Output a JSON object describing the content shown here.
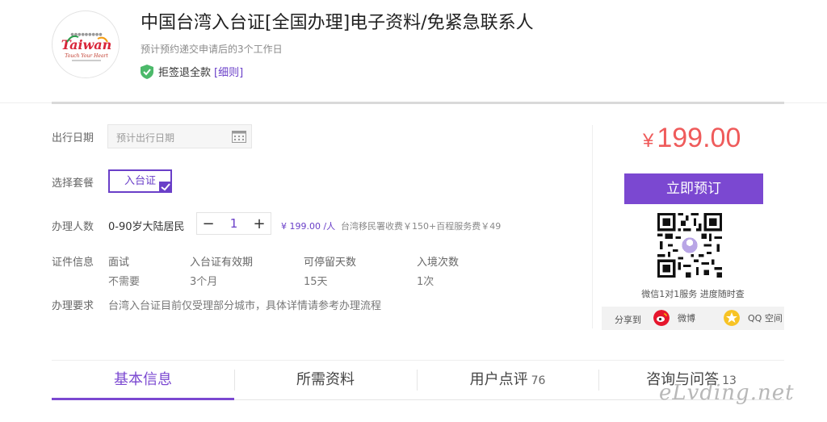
{
  "product": {
    "title": "中国台湾入台证[全国办理]电子资料/免紧急联系人",
    "subtitle": "预计预约递交申请后的3个工作日",
    "refund_label": "拒签退全款",
    "refund_detail_link": "[细则]",
    "logo_text": "Taiwan",
    "logo_slogan": "Touch Your Heart"
  },
  "form": {
    "date_label": "出行日期",
    "date_placeholder": "预计出行日期",
    "package_label": "选择套餐",
    "package_selected": "入台证",
    "persons_label": "办理人数",
    "person_type": "0-90岁大陆居民",
    "quantity": "1",
    "minus": "−",
    "plus": "+",
    "unit_price": "¥ 199.00 /人",
    "fee_note": "台湾移民署收费￥150+百程服务费￥49",
    "cert_label": "证件信息",
    "cert_columns": [
      {
        "head": "面试",
        "value": "不需要"
      },
      {
        "head": "入台证有效期",
        "value": "3个月"
      },
      {
        "head": "可停留天数",
        "value": "15天"
      },
      {
        "head": "入境次数",
        "value": "1次"
      }
    ],
    "requirement_label": "办理要求",
    "requirement_text": "台湾入台证目前仅受理部分城市，具体详情请参考办理流程"
  },
  "sidebar": {
    "currency": "¥",
    "price": "199.00",
    "book_button": "立即预订",
    "qr_caption": "微信1对1服务 进度随时查",
    "share_label": "分享到",
    "share_weibo": "微博",
    "share_qq": "QQ 空间"
  },
  "tabs": [
    {
      "label": "基本信息",
      "count": ""
    },
    {
      "label": "所需资料",
      "count": ""
    },
    {
      "label": "用户点评",
      "count": "76"
    },
    {
      "label": "咨询与问答",
      "count": "13"
    }
  ],
  "watermark": "eLvding.net",
  "colors": {
    "accent": "#7b48d1",
    "price": "#ef5b5b",
    "shield": "#4cb96a"
  }
}
